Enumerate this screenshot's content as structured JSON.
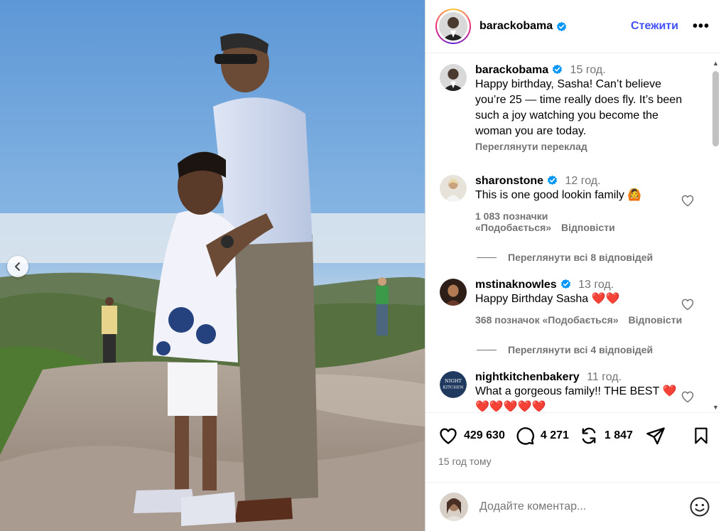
{
  "post": {
    "author": "barackobama",
    "follow_label": "Стежити",
    "more_label": "•••",
    "caption": "Happy birthday, Sasha! Can’t believe you’re 25 — time really does fly. It’s been such a joy watching you become the woman you are today.",
    "caption_time": "15 год.",
    "translate_label": "Переглянути переклад"
  },
  "comments": [
    {
      "username": "sharonstone",
      "time": "12 год.",
      "text": "This is one good lookin family 🙆",
      "likes": "1 083 позначки «Подобається»",
      "reply_label": "Відповісти",
      "view_replies": "Переглянути всі 8 відповідей"
    },
    {
      "username": "mstinaknowles",
      "time": "13 год.",
      "text": "Happy Birthday Sasha ❤️❤️",
      "likes": "368 позначок «Подобається»",
      "reply_label": "Відповісти",
      "view_replies": "Переглянути всі 4 відповідей"
    },
    {
      "username": "nightkitchenbakery",
      "time": "11 год.",
      "text": "What a gorgeous family!! THE BEST ❤️❤️❤️❤️❤️❤️"
    }
  ],
  "actions": {
    "likes_count": "429 630",
    "comments_count": "4 271",
    "reposts_count": "1 847",
    "posted_ago": "15 год тому"
  },
  "add_comment": {
    "placeholder": "Додайте коментар..."
  },
  "icons": {
    "prev": "chevron-left-icon",
    "like": "heart-icon",
    "comment": "comment-icon",
    "repost": "repost-icon",
    "share": "send-icon",
    "save": "bookmark-icon",
    "emoji": "smiley-icon",
    "verified": "verified-badge-icon"
  },
  "colors": {
    "follow": "#4150f7",
    "verified": "#0095f6",
    "muted": "#737373"
  }
}
